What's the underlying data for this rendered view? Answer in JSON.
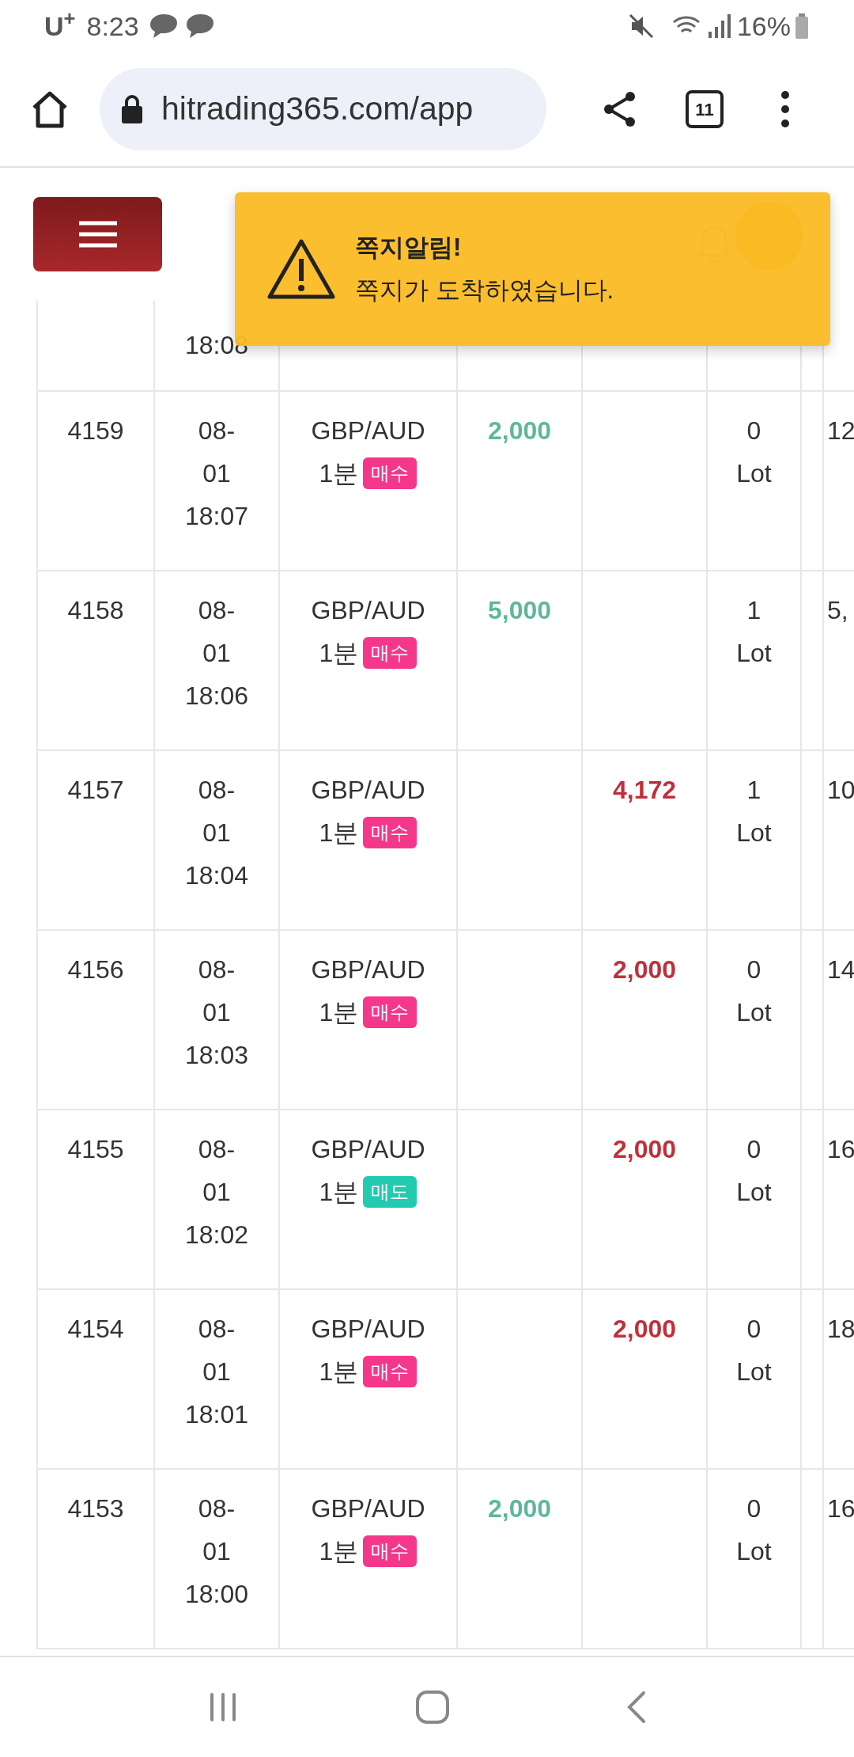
{
  "status_bar": {
    "carrier": "U$^{+}$",
    "time": "8:23",
    "battery": "16%"
  },
  "browser": {
    "url": "hitrading365.com/app",
    "tab_count": "11"
  },
  "toast": {
    "title": "쪽지알림!",
    "message": "쪽지가 도착하였습니다."
  },
  "table": {
    "partial_row": {
      "time": "18:08"
    },
    "rows": [
      {
        "number": "4159",
        "time": "08-01 18:07",
        "symbol": "GBP/AUD",
        "period": "1분",
        "side": {
          "label": "매수",
          "kind": "buy"
        },
        "column_4": "2,000",
        "lot": "0 Lot",
        "column_8": "12"
      },
      {
        "number": "4158",
        "time": "08-01 18:06",
        "symbol": "GBP/AUD",
        "period": "1분",
        "side": {
          "label": "매수",
          "kind": "buy"
        },
        "column_4": "5,000",
        "lot": "1 Lot",
        "column_8": "5,"
      },
      {
        "number": "4157",
        "time": "08-01 18:04",
        "symbol": "GBP/AUD",
        "period": "1분",
        "side": {
          "label": "매수",
          "kind": "buy"
        },
        "column_5": "4,172",
        "lot": "1 Lot",
        "column_8": "10"
      },
      {
        "number": "4156",
        "time": "08-01 18:03",
        "symbol": "GBP/AUD",
        "period": "1분",
        "side": {
          "label": "매수",
          "kind": "buy"
        },
        "column_5": "2,000",
        "lot": "0 Lot",
        "column_8": "14"
      },
      {
        "number": "4155",
        "time": "08-01 18:02",
        "symbol": "GBP/AUD",
        "period": "1분",
        "side": {
          "label": "매도",
          "kind": "sell"
        },
        "column_5": "2,000",
        "lot": "0 Lot",
        "column_8": "16"
      },
      {
        "number": "4154",
        "time": "08-01 18:01",
        "symbol": "GBP/AUD",
        "period": "1분",
        "side": {
          "label": "매수",
          "kind": "buy"
        },
        "column_5": "2,000",
        "lot": "0 Lot",
        "column_8": "18"
      },
      {
        "number": "4153",
        "time": "08-01 18:00",
        "symbol": "GBP/AUD",
        "period": "1분",
        "side": {
          "label": "매수",
          "kind": "buy"
        },
        "column_4": "2,000",
        "lot": "0 Lot",
        "column_8": "16"
      }
    ]
  }
}
